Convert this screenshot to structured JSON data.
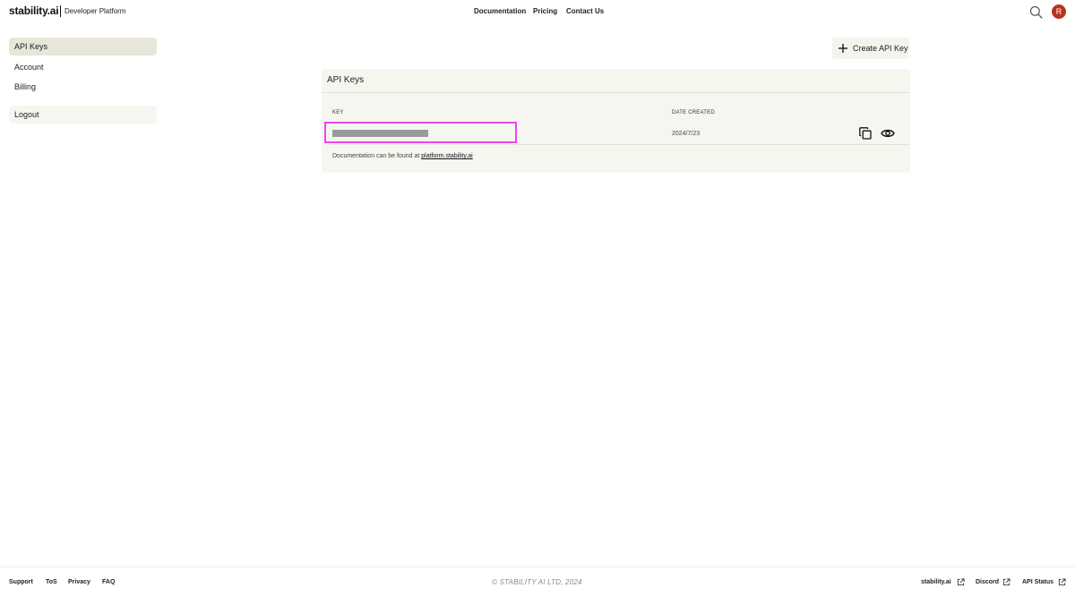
{
  "header": {
    "logo": "stability.ai",
    "platform": "Developer Platform",
    "nav": [
      "Documentation",
      "Pricing",
      "Contact Us"
    ],
    "avatar_initial": "R",
    "avatar_color": "#b8331c"
  },
  "sidebar": {
    "items": [
      {
        "label": "API Keys",
        "active": true
      },
      {
        "label": "Account",
        "active": false
      },
      {
        "label": "Billing",
        "active": false
      },
      {
        "label": "Logout",
        "active": false
      }
    ]
  },
  "main": {
    "create_label": "Create API Key",
    "card_title": "API Keys",
    "columns": {
      "key": "KEY",
      "date": "DATE CREATED"
    },
    "rows": [
      {
        "date": "2024/7/23"
      }
    ],
    "doc_note": "Documentation can be found at",
    "doc_link": "platform.stability.ai"
  },
  "footer": {
    "left_links": [
      "Support",
      "ToS",
      "Privacy",
      "FAQ"
    ],
    "copyright": "© STABILITY AI LTD, 2024",
    "right_links": [
      "stability.ai",
      "Discord",
      "API Status"
    ]
  },
  "colors": {
    "accent_highlight": "#ee44ee",
    "active_nav_bg": "#e7e6d9",
    "card_bg": "#f6f6f0"
  }
}
